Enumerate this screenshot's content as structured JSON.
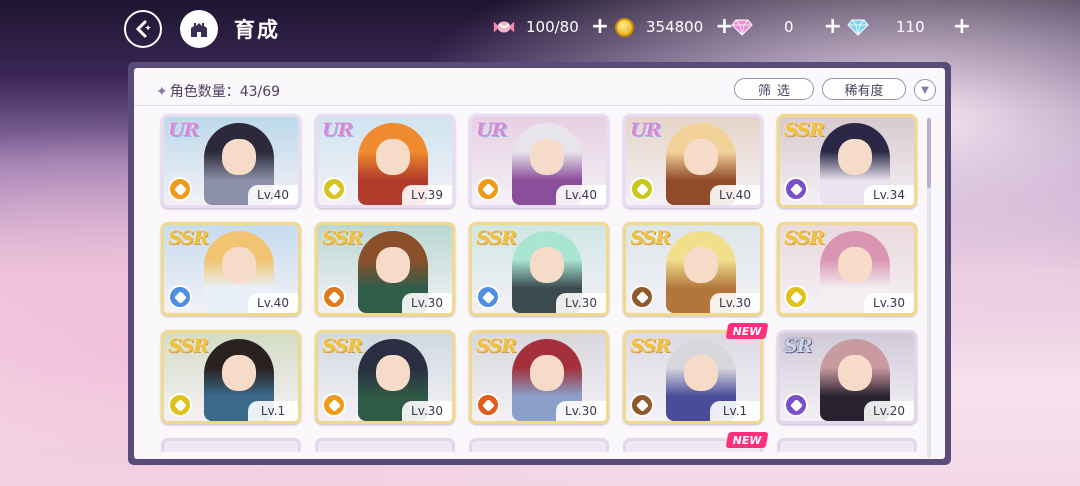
{
  "header": {
    "title": "育成",
    "currencies": [
      {
        "icon": "candy-icon",
        "value": "100/80"
      },
      {
        "icon": "coin-icon",
        "value": "354800"
      },
      {
        "icon": "pink-diamond-icon",
        "value": "0"
      },
      {
        "icon": "blue-diamond-icon",
        "value": "110"
      }
    ]
  },
  "panel": {
    "count_label": "角色数量：43/69",
    "filter_label": "筛选",
    "rarity_label": "稀有度"
  },
  "cards": [
    {
      "rarity": "UR",
      "level": "Lv.40",
      "attr_color": "#f09a1a",
      "bg": "#bcd9ea",
      "hair": "#2c2a3a",
      "outfit": "#8b8fa8",
      "new": false
    },
    {
      "rarity": "UR",
      "level": "Lv.39",
      "attr_color": "#d8c21f",
      "bg": "#cfe4f0",
      "hair": "#ef8a2e",
      "outfit": "#b23a2a",
      "new": false
    },
    {
      "rarity": "UR",
      "level": "Lv.40",
      "attr_color": "#f09a1a",
      "bg": "#e7cfe2",
      "hair": "#e8e4ec",
      "outfit": "#8a4e9a",
      "new": false
    },
    {
      "rarity": "UR",
      "level": "Lv.40",
      "attr_color": "#c9c71c",
      "bg": "#e6d4c8",
      "hair": "#f3d29a",
      "outfit": "#8f4b2a",
      "new": false
    },
    {
      "rarity": "SSR",
      "level": "Lv.34",
      "attr_color": "#7b4fc9",
      "bg": "#d7c9cf",
      "hair": "#2a2846",
      "outfit": "#e9e3ef",
      "new": false
    },
    {
      "rarity": "SSR",
      "level": "Lv.40",
      "attr_color": "#4d8fe0",
      "bg": "#c6dcef",
      "hair": "#f0c470",
      "outfit": "#eaf0fa",
      "new": false
    },
    {
      "rarity": "SSR",
      "level": "Lv.30",
      "attr_color": "#e07a1a",
      "bg": "#b9d8d2",
      "hair": "#8b4f2c",
      "outfit": "#2e5e4a",
      "new": false
    },
    {
      "rarity": "SSR",
      "level": "Lv.30",
      "attr_color": "#4d8fe0",
      "bg": "#cfe6e4",
      "hair": "#a9e6d2",
      "outfit": "#3a4a4e",
      "new": false
    },
    {
      "rarity": "SSR",
      "level": "Lv.30",
      "attr_color": "#8f5a2c",
      "bg": "#dce6ea",
      "hair": "#f2df8c",
      "outfit": "#b0763a",
      "new": false
    },
    {
      "rarity": "SSR",
      "level": "Lv.30",
      "attr_color": "#e0c11a",
      "bg": "#ead9dc",
      "hair": "#d996b2",
      "outfit": "#f2eef2",
      "new": false
    },
    {
      "rarity": "SSR",
      "level": "Lv.1",
      "attr_color": "#e0c11a",
      "bg": "#d4dcc4",
      "hair": "#2a2220",
      "outfit": "#3b6a8a",
      "new": false
    },
    {
      "rarity": "SSR",
      "level": "Lv.30",
      "attr_color": "#f09a1a",
      "bg": "#cfd9e0",
      "hair": "#2a2e40",
      "outfit": "#2f5a46",
      "new": false
    },
    {
      "rarity": "SSR",
      "level": "Lv.30",
      "attr_color": "#e05a1a",
      "bg": "#d8d8dc",
      "hair": "#a3303a",
      "outfit": "#8aa0c8",
      "new": false
    },
    {
      "rarity": "SSR",
      "level": "Lv.1",
      "attr_color": "#8f5a2c",
      "bg": "#dcd9e4",
      "hair": "#d8d8dc",
      "outfit": "#4a4c9a",
      "new": true,
      "new_label": "NEW"
    },
    {
      "rarity": "SR",
      "level": "Lv.20",
      "attr_color": "#7b4fc9",
      "bg": "#d0cad8",
      "hair": "#c99aa0",
      "outfit": "#2a2230",
      "new": false
    }
  ],
  "partial_row": {
    "new_label": "NEW"
  }
}
